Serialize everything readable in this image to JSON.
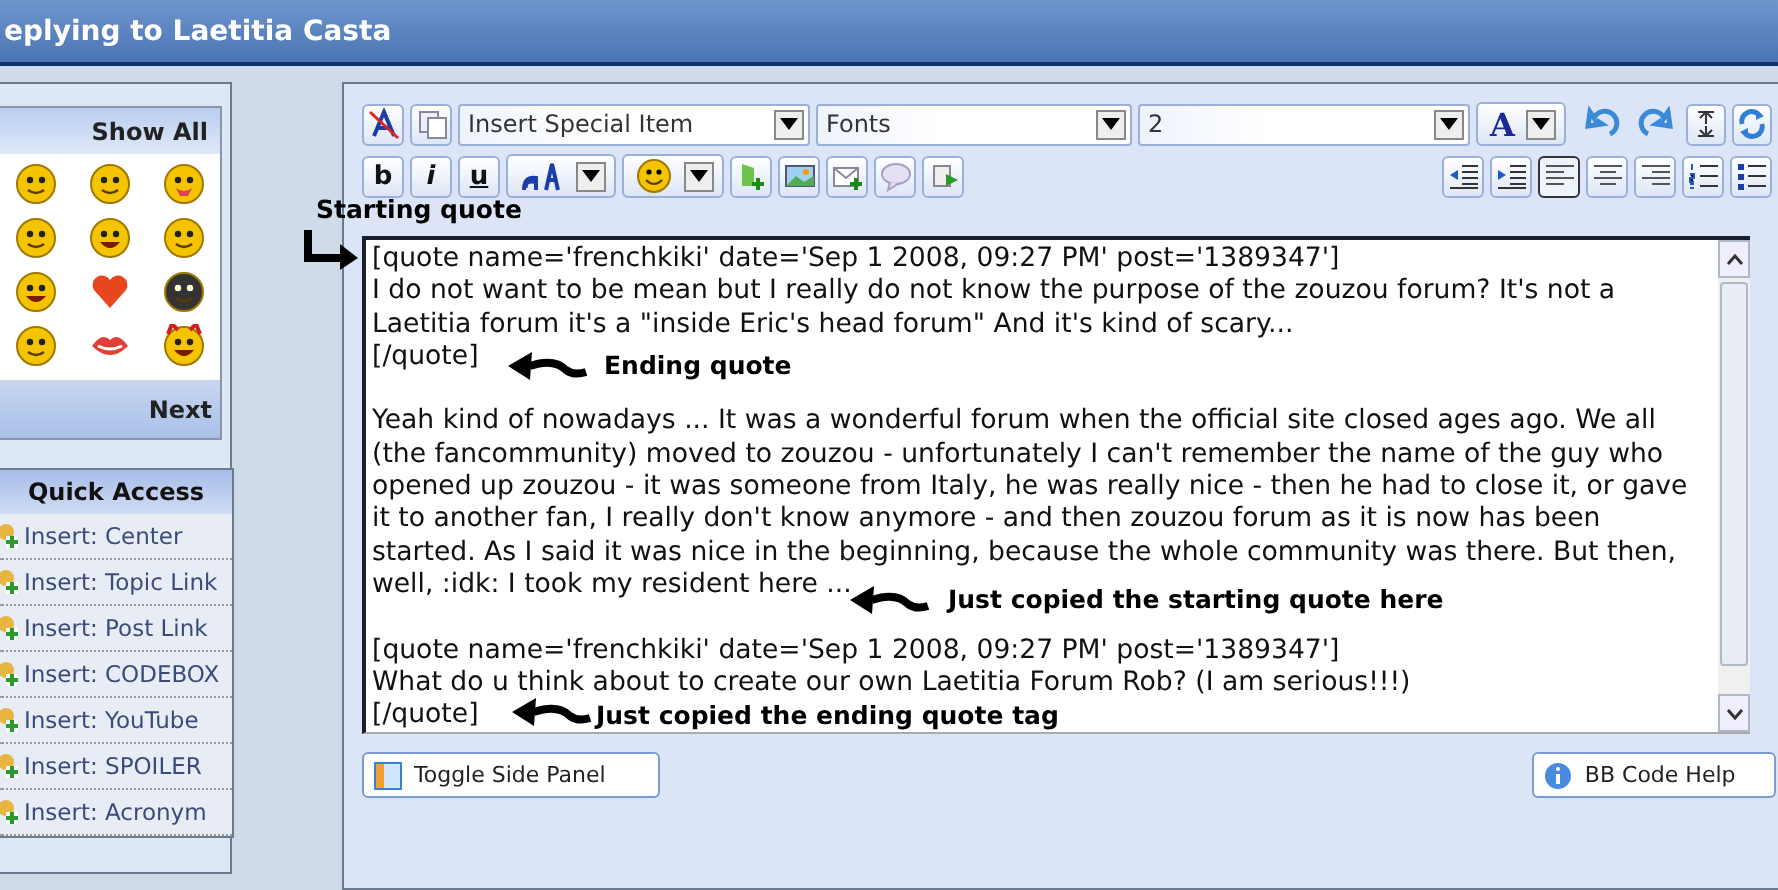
{
  "window": {
    "title": "eplying to Laetitia Casta"
  },
  "emoticons": {
    "header": "Show All",
    "footer": "Next"
  },
  "quick_access": {
    "title": "Quick Access",
    "items": [
      "Insert: Center",
      "Insert: Topic Link",
      "Insert: Post Link",
      "Insert: CODEBOX",
      "Insert: YouTube",
      "Insert: SPOILER",
      "Insert: Acronym"
    ]
  },
  "toolbar": {
    "selects": [
      {
        "value": "Insert Special Item"
      },
      {
        "value": "Fonts"
      },
      {
        "value": "2"
      }
    ],
    "color_button": "A",
    "format_buttons": [
      "b",
      "i",
      "u"
    ],
    "align_buttons": [
      {
        "kind": "outdent",
        "selected": false
      },
      {
        "kind": "indent",
        "selected": false
      },
      {
        "kind": "left",
        "selected": true
      },
      {
        "kind": "center",
        "selected": false
      },
      {
        "kind": "right",
        "selected": false
      },
      {
        "kind": "ordered",
        "selected": false
      },
      {
        "kind": "bullets",
        "selected": false
      }
    ]
  },
  "editor": {
    "paragraphs": [
      [
        "[quote name='frenchkiki' date='Sep 1 2008, 09:27 PM' post='1389347']",
        "I do not want to be mean but I really do not know the purpose of the zouzou forum? It's not a",
        "Laetitia forum it's a \"inside Eric's head forum\" And it's kind of scary...",
        "[/quote]"
      ],
      [
        "Yeah kind of nowadays ... It was a wonderful forum when the official site closed ages ago. We all",
        "(the fancommunity) moved to zouzou - unfortunately I can't remember the name of the guy who",
        "opened up zouzou - it was someone from Italy, he was really nice - then he had to close it, or gave",
        "it to another fan, I really don't know anymore - and then zouzou forum as it is now has been",
        "started. As I said it was nice in the beginning, because the whole community was there. But then,",
        "well, :idk: I took my resident here ..."
      ],
      [
        "[quote name='frenchkiki' date='Sep 1 2008, 09:27 PM' post='1389347']",
        "What do u think about to create our own Laetitia Forum Rob? (I am serious!!!)",
        "[/quote]"
      ]
    ]
  },
  "annotations": [
    {
      "text": "Starting quote"
    },
    {
      "text": "Ending quote"
    },
    {
      "text": "Just copied the starting quote here"
    },
    {
      "text": "Just copied the ending quote tag"
    }
  ],
  "buttons": [
    {
      "label": "Toggle Side Panel"
    },
    {
      "label": "BB Code Help"
    }
  ]
}
